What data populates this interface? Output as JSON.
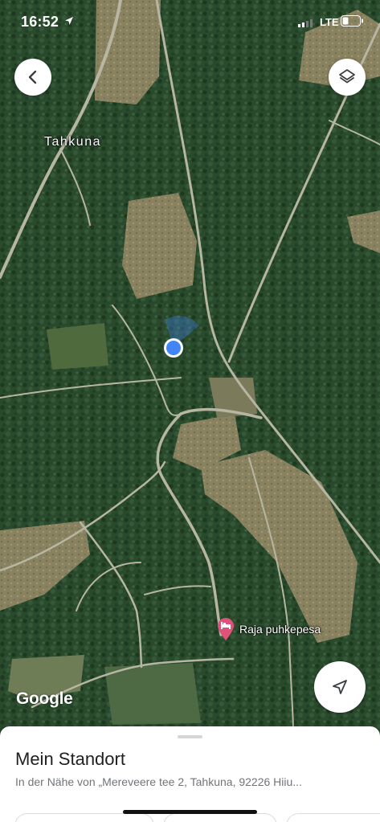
{
  "status_bar": {
    "time": "16:52",
    "network": "LTE",
    "icons": [
      "location-arrow-icon",
      "signal-icon",
      "battery-icon"
    ]
  },
  "map": {
    "place_label": "Tahkuna",
    "poi_label": "Raja puhkepesa",
    "poi_icon": "bed-icon",
    "poi_color": "#e0527a",
    "location_dot_color": "#4285f4",
    "attribution": "Google"
  },
  "buttons": {
    "back_icon": "back-arrow-icon",
    "layers_icon": "layers-icon",
    "navigate_icon": "navigation-arrow-icon"
  },
  "sheet": {
    "title": "Mein Standort",
    "subtitle": "In der Nähe von „Mereveere tee 2, Tahkuna, 92226 Hiiu..."
  }
}
